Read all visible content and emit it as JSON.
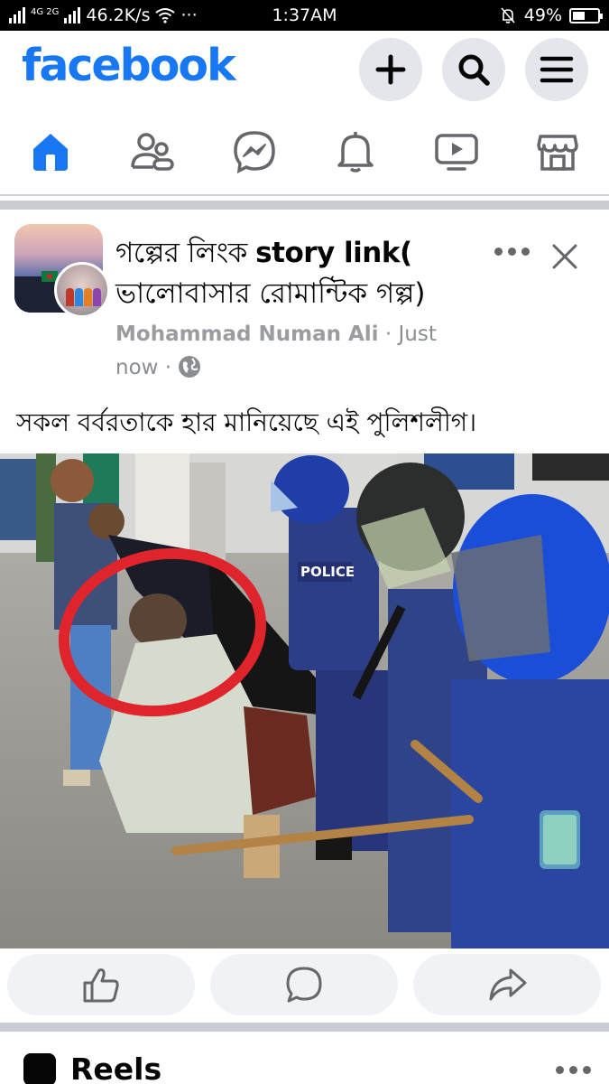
{
  "status_bar": {
    "network": "4G 2G",
    "speed": "46.2K/s",
    "overflow": "···",
    "time": "1:37AM",
    "battery": "49%",
    "battery_level": 0.49,
    "icons": [
      "signal-icon",
      "wifi-icon",
      "bell-off-icon",
      "battery-icon"
    ]
  },
  "header": {
    "logo": "facebook",
    "logo_color": "#1877f2",
    "buttons": [
      "plus-icon",
      "search-icon",
      "menu-icon"
    ]
  },
  "nav": {
    "tabs": [
      "home-icon",
      "friends-icon",
      "messenger-icon",
      "notifications-icon",
      "video-icon",
      "marketplace-icon"
    ],
    "active_tab": "home-icon",
    "active_color": "#1877f2",
    "inactive_color": "#65676b"
  },
  "post": {
    "title_line1_bn": "গল্পের লিংক ",
    "title_line1_en": "story link(",
    "title_line2": "ভালোবাসার রোমান্টিক গল্প)",
    "author": "Mohammad Numan Ali",
    "time_sep": " · ",
    "time_part1": "Just",
    "time_part2": "now",
    "privacy_sep": " · ",
    "privacy_icon": "globe-icon",
    "caption": "সকল বর্বরতাকে হার মানিয়েছে এই পুলিশলীগ।",
    "photo_text": "POLICE",
    "actions": [
      "like-icon",
      "comment-icon",
      "share-icon"
    ]
  },
  "reels": {
    "label": "Reels"
  }
}
